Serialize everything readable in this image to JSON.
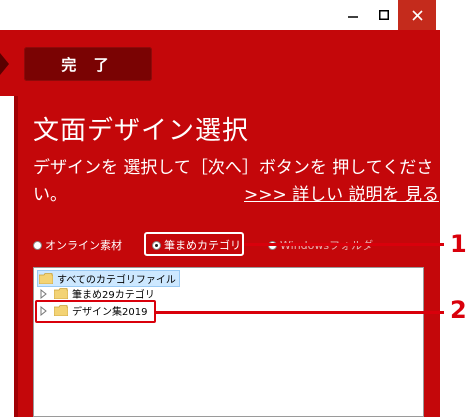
{
  "window": {
    "controls": {
      "minimize": "minimize",
      "maximize": "maximize",
      "close": "close"
    }
  },
  "toolbar": {
    "done_label": "完 了"
  },
  "main": {
    "title": "文面デザイン選択",
    "instruction_line1": "デザインを 選択して［次へ］ボタンを 押してくださ",
    "instruction_line2": "い。",
    "detail_link": ">>> 詳しい 説明を 見る"
  },
  "source_options": [
    {
      "label": "オンライン素材",
      "selected": false
    },
    {
      "label": "筆まめカテゴリ",
      "selected": true
    },
    {
      "label": "Windowsフォルダ",
      "selected": false
    }
  ],
  "category_tree": {
    "root": "すべてのカテゴリファイル",
    "children": [
      "筆まめ29カテゴリ",
      "デザイン集2019"
    ]
  },
  "callouts": [
    "1",
    "2"
  ],
  "colors": {
    "panel_red": "#c4070a",
    "dark_button": "#7a0303",
    "callout_red": "#d9000b",
    "close_red": "#c42b1c"
  }
}
